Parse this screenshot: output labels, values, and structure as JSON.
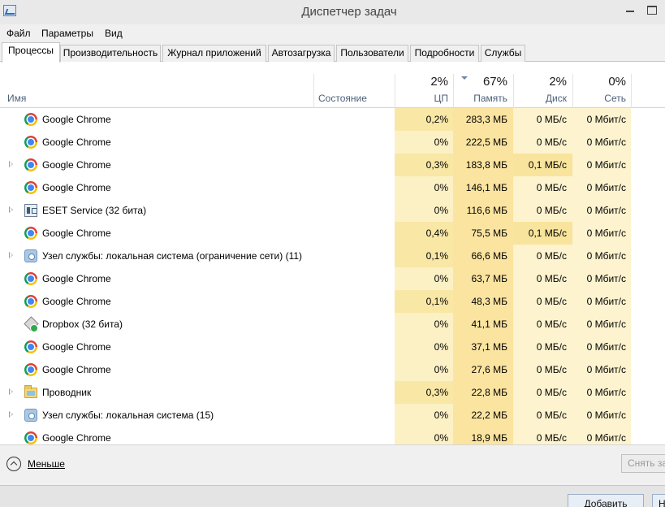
{
  "window": {
    "title": "Диспетчер задач"
  },
  "menu": [
    "Файл",
    "Параметры",
    "Вид"
  ],
  "tabs": [
    {
      "label": "Процессы",
      "active": true
    },
    {
      "label": "Производительность",
      "active": false
    },
    {
      "label": "Журнал приложений",
      "active": false
    },
    {
      "label": "Автозагрузка",
      "active": false
    },
    {
      "label": "Пользователи",
      "active": false
    },
    {
      "label": "Подробности",
      "active": false
    },
    {
      "label": "Службы",
      "active": false
    }
  ],
  "columns": {
    "name": "Имя",
    "status": "Состояние",
    "cpu": {
      "pct": "2%",
      "label": "ЦП"
    },
    "memory": {
      "pct": "67%",
      "label": "Память"
    },
    "disk": {
      "pct": "2%",
      "label": "Диск"
    },
    "network": {
      "pct": "0%",
      "label": "Сеть"
    }
  },
  "colors": {
    "cpu_bg": "#fcf1c5",
    "memory_bg": "#fbe4a0",
    "disk_bg": "#fdf3cf",
    "network_bg": "#fdf3cf",
    "highlight_cpu": "#f9e7a6",
    "highlight_disk": "#f8e49c"
  },
  "processes": [
    {
      "name": "Google Chrome",
      "icon": "chrome-icon",
      "expandable": false,
      "cpu": "0,2%",
      "memory": "283,3 МБ",
      "disk": "0 МБ/с",
      "network": "0 Мбит/с",
      "cpu_hi": true,
      "disk_hi": false
    },
    {
      "name": "Google Chrome",
      "icon": "chrome-icon",
      "expandable": false,
      "cpu": "0%",
      "memory": "222,5 МБ",
      "disk": "0 МБ/с",
      "network": "0 Мбит/с",
      "cpu_hi": false,
      "disk_hi": false
    },
    {
      "name": "Google Chrome",
      "icon": "chrome-icon",
      "expandable": true,
      "cpu": "0,3%",
      "memory": "183,8 МБ",
      "disk": "0,1 МБ/с",
      "network": "0 Мбит/с",
      "cpu_hi": true,
      "disk_hi": true
    },
    {
      "name": "Google Chrome",
      "icon": "chrome-icon",
      "expandable": false,
      "cpu": "0%",
      "memory": "146,1 МБ",
      "disk": "0 МБ/с",
      "network": "0 Мбит/с",
      "cpu_hi": false,
      "disk_hi": false
    },
    {
      "name": "ESET Service (32 бита)",
      "icon": "eset-icon",
      "expandable": true,
      "cpu": "0%",
      "memory": "116,6 МБ",
      "disk": "0 МБ/с",
      "network": "0 Мбит/с",
      "cpu_hi": false,
      "disk_hi": false
    },
    {
      "name": "Google Chrome",
      "icon": "chrome-icon",
      "expandable": false,
      "cpu": "0,4%",
      "memory": "75,5 МБ",
      "disk": "0,1 МБ/с",
      "network": "0 Мбит/с",
      "cpu_hi": true,
      "disk_hi": true
    },
    {
      "name": "Узел службы: локальная система (ограничение сети) (11)",
      "icon": "gear-icon",
      "expandable": true,
      "cpu": "0,1%",
      "memory": "66,6 МБ",
      "disk": "0 МБ/с",
      "network": "0 Мбит/с",
      "cpu_hi": true,
      "disk_hi": false
    },
    {
      "name": "Google Chrome",
      "icon": "chrome-icon",
      "expandable": false,
      "cpu": "0%",
      "memory": "63,7 МБ",
      "disk": "0 МБ/с",
      "network": "0 Мбит/с",
      "cpu_hi": false,
      "disk_hi": false
    },
    {
      "name": "Google Chrome",
      "icon": "chrome-icon",
      "expandable": false,
      "cpu": "0,1%",
      "memory": "48,3 МБ",
      "disk": "0 МБ/с",
      "network": "0 Мбит/с",
      "cpu_hi": true,
      "disk_hi": false
    },
    {
      "name": "Dropbox (32 бита)",
      "icon": "dropbox-icon",
      "expandable": false,
      "cpu": "0%",
      "memory": "41,1 МБ",
      "disk": "0 МБ/с",
      "network": "0 Мбит/с",
      "cpu_hi": false,
      "disk_hi": false
    },
    {
      "name": "Google Chrome",
      "icon": "chrome-icon",
      "expandable": false,
      "cpu": "0%",
      "memory": "37,1 МБ",
      "disk": "0 МБ/с",
      "network": "0 Мбит/с",
      "cpu_hi": false,
      "disk_hi": false
    },
    {
      "name": "Google Chrome",
      "icon": "chrome-icon",
      "expandable": false,
      "cpu": "0%",
      "memory": "27,6 МБ",
      "disk": "0 МБ/с",
      "network": "0 Мбит/с",
      "cpu_hi": false,
      "disk_hi": false
    },
    {
      "name": "Проводник",
      "icon": "folder-icon",
      "expandable": true,
      "cpu": "0,3%",
      "memory": "22,8 МБ",
      "disk": "0 МБ/с",
      "network": "0 Мбит/с",
      "cpu_hi": true,
      "disk_hi": false
    },
    {
      "name": "Узел службы: локальная система (15)",
      "icon": "gear-icon",
      "expandable": true,
      "cpu": "0%",
      "memory": "22,2 МБ",
      "disk": "0 МБ/с",
      "network": "0 Мбит/с",
      "cpu_hi": false,
      "disk_hi": false
    },
    {
      "name": "Google Chrome",
      "icon": "chrome-icon",
      "expandable": false,
      "cpu": "0%",
      "memory": "18,9 МБ",
      "disk": "0 МБ/с",
      "network": "0 Мбит/с",
      "cpu_hi": false,
      "disk_hi": false
    }
  ],
  "footer": {
    "less_label": "Меньше",
    "end_task_label": "Снять задачу"
  },
  "background_window": {
    "add_label": "Добавить",
    "next_label": "Н"
  }
}
